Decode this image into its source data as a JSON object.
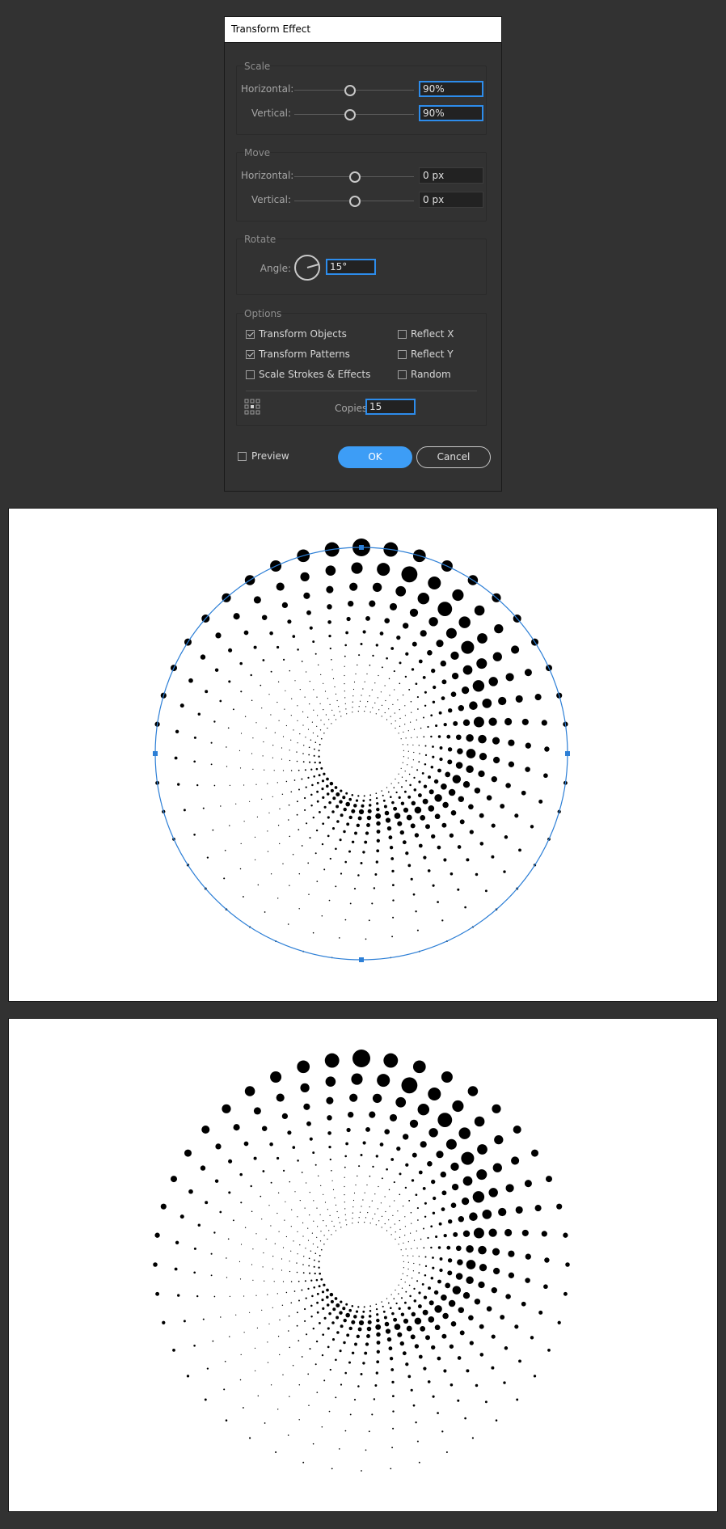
{
  "dialog": {
    "title": "Transform Effect",
    "scale": {
      "label": "Scale",
      "horizontal_label": "Horizontal:",
      "horizontal_value": "90%",
      "vertical_label": "Vertical:",
      "vertical_value": "90%"
    },
    "move": {
      "label": "Move",
      "horizontal_label": "Horizontal:",
      "horizontal_value": "0 px",
      "vertical_label": "Vertical:",
      "vertical_value": "0 px"
    },
    "rotate": {
      "label": "Rotate",
      "angle_label": "Angle:",
      "angle_value": "15°"
    },
    "options": {
      "label": "Options",
      "transform_objects": "Transform Objects",
      "transform_patterns": "Transform Patterns",
      "scale_strokes": "Scale Strokes & Effects",
      "reflect_x": "Reflect X",
      "reflect_y": "Reflect Y",
      "random": "Random",
      "copies_label": "Copies",
      "copies_value": "15"
    },
    "preview_label": "Preview",
    "ok_label": "OK",
    "cancel_label": "Cancel"
  },
  "colors": {
    "accent": "#2d8ceb",
    "ok_button": "#3d9df6",
    "selection_path": "#2d7fd6",
    "dots": "#000000"
  }
}
